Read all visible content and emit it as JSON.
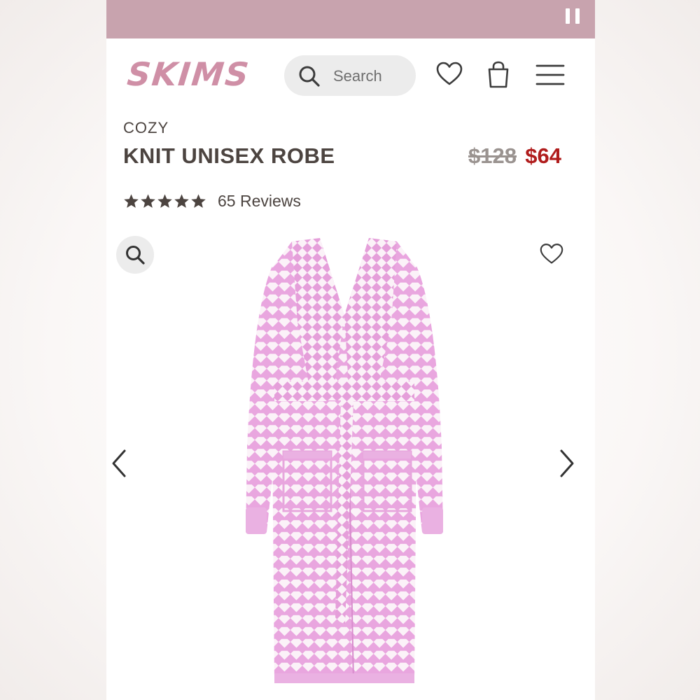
{
  "header": {
    "logo_text": "SKIMS",
    "search_placeholder": "Search",
    "icons": [
      "search-icon",
      "heart-icon",
      "shopping-bag-icon",
      "hamburger-menu-icon"
    ]
  },
  "status_bar": {
    "icon": "pause-icon",
    "color": "#c8a3ae"
  },
  "product": {
    "category": "COZY",
    "name": "KNIT UNISEX ROBE",
    "price_original": "$128",
    "price_sale": "$64",
    "rating_stars": 5,
    "reviews_label": "65 Reviews"
  },
  "gallery": {
    "image_subject": "pink houndstooth knit robe",
    "controls": [
      "zoom-icon",
      "heart-icon",
      "chevron-left-icon",
      "chevron-right-icon"
    ]
  },
  "colors": {
    "brand_pink": "#cf8fa6",
    "text": "#4c4440",
    "sale_red": "#b01c1c",
    "robe_pink": "#e9a6df"
  }
}
